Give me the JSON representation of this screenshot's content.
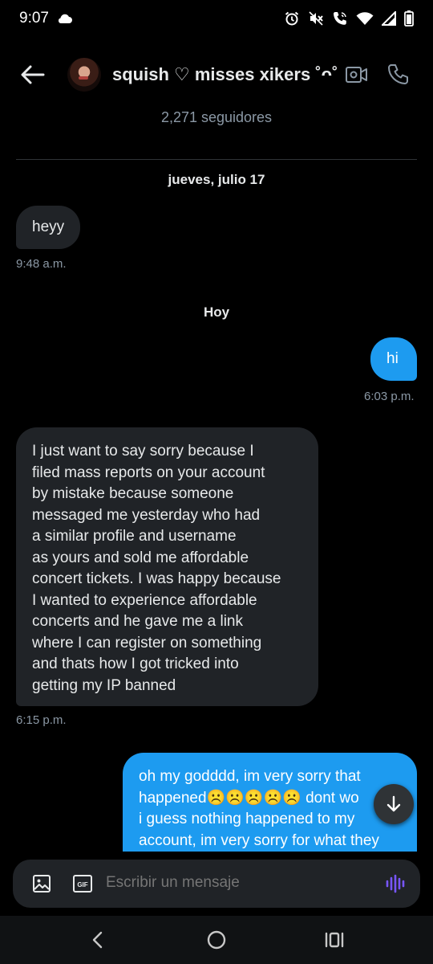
{
  "status_bar": {
    "time": "9:07",
    "left_icons": [
      "cloud-icon"
    ],
    "right_icons": [
      "alarm-icon",
      "mute-icon",
      "wifi-calling-icon",
      "wifi-icon",
      "signal-icon",
      "battery-icon"
    ]
  },
  "header": {
    "title": "squish ♡ misses xikers ˚ᴖ˚",
    "followers": "2,271 seguidores",
    "icons": [
      "back-arrow-icon",
      "avatar",
      "video-call-icon",
      "phone-icon"
    ]
  },
  "conversation": {
    "date_1": "jueves, julio 17",
    "date_2": "Hoy",
    "messages": [
      {
        "direction": "in",
        "text": "heyy",
        "time": "9:48 a.m."
      },
      {
        "direction": "out",
        "text": "hi",
        "time": "6:03 p.m."
      },
      {
        "direction": "in",
        "lines": [
          "I just want to say sorry because I",
          "filed mass reports on your account",
          "by mistake because someone",
          "messaged me yesterday who had",
          "a similar profile and username",
          "as yours and sold me affordable",
          "concert tickets. I was happy because",
          "I wanted to experience affordable",
          "concerts and he gave me a link",
          "where I can register on something",
          "and thats how I got tricked into",
          "getting my IP banned"
        ],
        "time": "6:15 p.m."
      },
      {
        "direction": "out",
        "lines": [
          "oh my godddd, im very sorry that",
          "happened☹️☹️☹️☹️☹️ dont wo",
          "i guess nothing happened to my",
          "account, im very sorry for what they"
        ]
      }
    ]
  },
  "composer": {
    "placeholder": "Escribir un mensaje",
    "gif_label": "GIF"
  },
  "colors": {
    "background": "#000000",
    "incoming_bubble": "#202327",
    "outgoing_bubble": "#1d9bf0",
    "secondary_text": "#8b98a5",
    "voice_accent": "#7856ff"
  }
}
